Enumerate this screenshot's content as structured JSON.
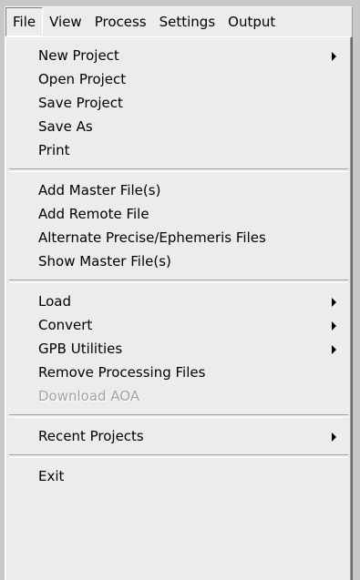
{
  "menubar": {
    "items": [
      "File",
      "View",
      "Process",
      "Settings",
      "Output"
    ]
  },
  "file_menu": {
    "items": [
      {
        "label": "New Project",
        "submenu": true
      },
      {
        "label": "Open Project"
      },
      {
        "label": "Save Project"
      },
      {
        "label": "Save As"
      },
      {
        "label": "Print"
      },
      {
        "label": "Add Master File(s)"
      },
      {
        "label": "Add Remote File"
      },
      {
        "label": "Alternate Precise/Ephemeris Files"
      },
      {
        "label": "Show Master File(s)"
      },
      {
        "label": "Load",
        "submenu": true
      },
      {
        "label": "Convert",
        "submenu": true
      },
      {
        "label": "GPB Utilities",
        "submenu": true
      },
      {
        "label": "Remove Processing Files"
      },
      {
        "label": "Download AOA",
        "disabled": true
      },
      {
        "label": "Recent Projects",
        "submenu": true
      },
      {
        "label": "Exit"
      }
    ]
  },
  "icons": {
    "submenu_arrow": "triangle-right-icon"
  }
}
